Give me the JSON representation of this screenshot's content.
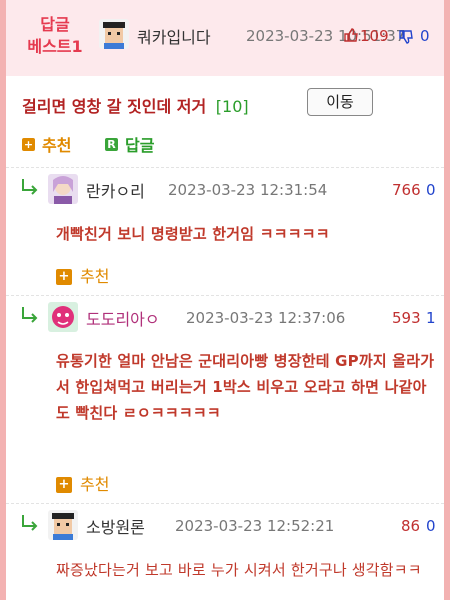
{
  "best": {
    "label_line1": "답글",
    "label_line2": "베스트1",
    "nickname": "쿼카입니다",
    "date": "2023-03-23 10:51:37",
    "up_count": "5",
    "up_count2": "109",
    "down_count": "0"
  },
  "post": {
    "title": "걸리면 영창 갈 짓인데 저거",
    "comment_count": "[10]",
    "move_button": "이동"
  },
  "actions": {
    "recommend_label": "추천",
    "reply_label": "답글",
    "plus_glyph": "+",
    "reply_glyph": "R"
  },
  "comments": [
    {
      "nickname": "란카ㅇ리",
      "date": "2023-03-23 12:31:54",
      "up": "766",
      "down": "0",
      "body": "개빡친거 보니 명령받고 한거임 ㅋㅋㅋㅋㅋ",
      "recommend": "추천"
    },
    {
      "nickname": "도도리아ㅇ",
      "date": "2023-03-23 12:37:06",
      "up": "593",
      "down": "1",
      "body": "유통기한 얼마 안남은 군대리아빵 병장한테 GP까지 올라가서 한입쳐먹고 버리는거 1박스 비우고 오라고 하면 나같아도 빡친다 ㄹㅇㅋㅋㅋㅋㅋ",
      "recommend": "추천"
    },
    {
      "nickname": "소방원론",
      "date": "2023-03-23 12:52:21",
      "up": "86",
      "down": "0",
      "body": "짜증났다는거 보고 바로 누가 시켜서 한거구나 생각함ㅋㅋ"
    }
  ],
  "colors": {
    "accent_red": "#e53a4f",
    "title_red": "#b22222",
    "count_green": "#2a9d2a",
    "recommend_orange": "#e08a00",
    "up_red": "#c03030",
    "down_blue": "#2244cc"
  }
}
